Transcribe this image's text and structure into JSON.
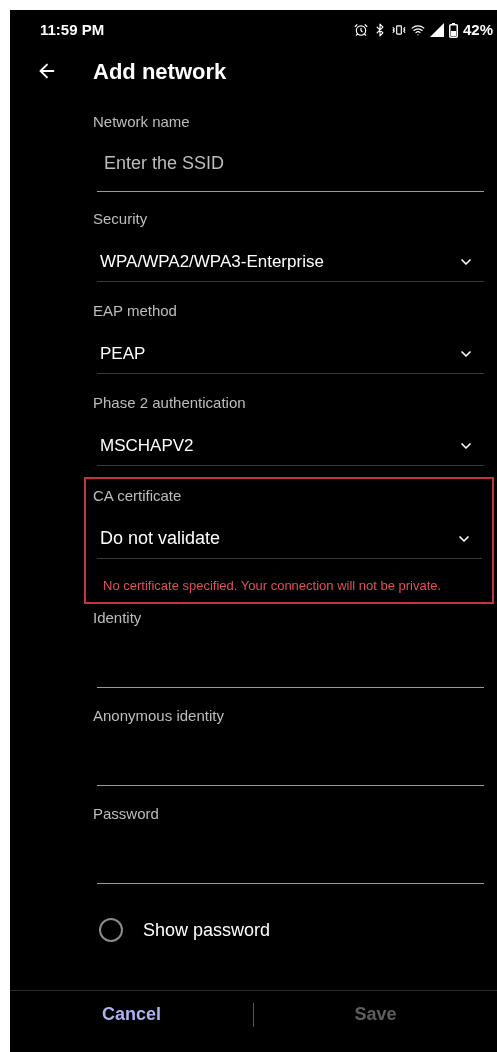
{
  "status_bar": {
    "time": "11:59 PM",
    "battery": "42%"
  },
  "header": {
    "title": "Add network"
  },
  "fields": [
    {
      "kind": "text",
      "label": "Network name",
      "placeholder": "Enter the SSID"
    },
    {
      "kind": "dropdown",
      "label": "Security",
      "value": "WPA/WPA2/WPA3-Enterprise",
      "highlighted": false
    },
    {
      "kind": "dropdown",
      "label": "EAP method",
      "value": "PEAP",
      "highlighted": false
    },
    {
      "kind": "dropdown",
      "label": "Phase 2 authentication",
      "value": "MSCHAPV2",
      "highlighted": false
    },
    {
      "kind": "dropdown",
      "label": "CA certificate",
      "value": "Do not validate",
      "highlighted": true,
      "error": "No certificate specified. Your connection will not be private."
    },
    {
      "kind": "text",
      "label": "Identity"
    },
    {
      "kind": "text",
      "label": "Anonymous identity"
    },
    {
      "kind": "text",
      "label": "Password"
    }
  ],
  "show_password": {
    "label": "Show password",
    "checked": false
  },
  "buttons": [
    {
      "label": "Cancel",
      "disabled": false
    },
    {
      "label": "Save",
      "disabled": true
    }
  ]
}
